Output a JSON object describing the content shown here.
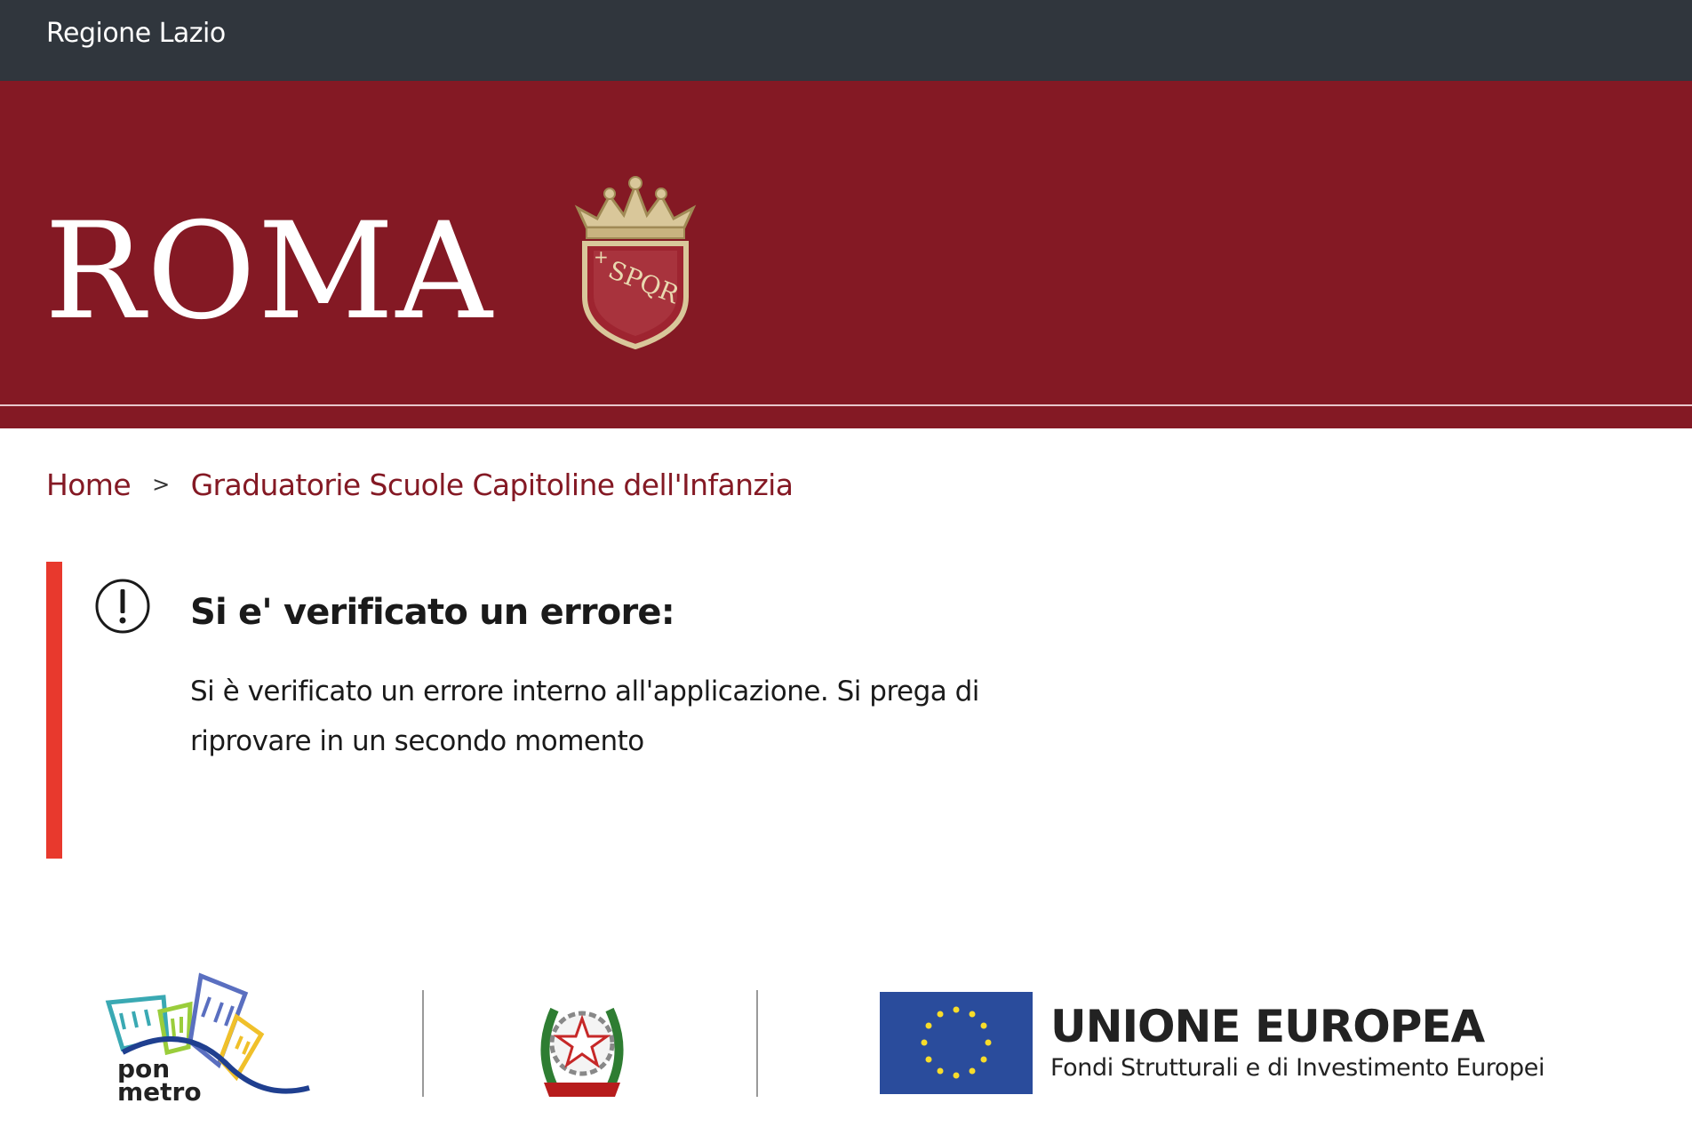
{
  "topbar": {
    "region_link": "Regione Lazio"
  },
  "brand": {
    "title": "ROMA",
    "crest_text": "SPQR"
  },
  "breadcrumb": {
    "items": [
      "Home",
      "Graduatorie Scuole Capitoline dell'Infanzia"
    ],
    "separator": ">"
  },
  "alert": {
    "title": "Si e' verificato un errore:",
    "message": "Si è verificato un errore interno all'applicazione. Si prega di riprovare in un secondo momento",
    "accent_color": "#e8392d"
  },
  "footer": {
    "pon_metro_line1": "pon",
    "pon_metro_line2": "metro",
    "eu_title": "UNIONE EUROPEA",
    "eu_subtitle": "Fondi Strutturali e di Investimento Europei"
  },
  "colors": {
    "topbar": "#30363d",
    "brand": "#841924",
    "link": "#841924",
    "eu_blue": "#2a4c9c",
    "eu_star": "#f7dc2a"
  }
}
